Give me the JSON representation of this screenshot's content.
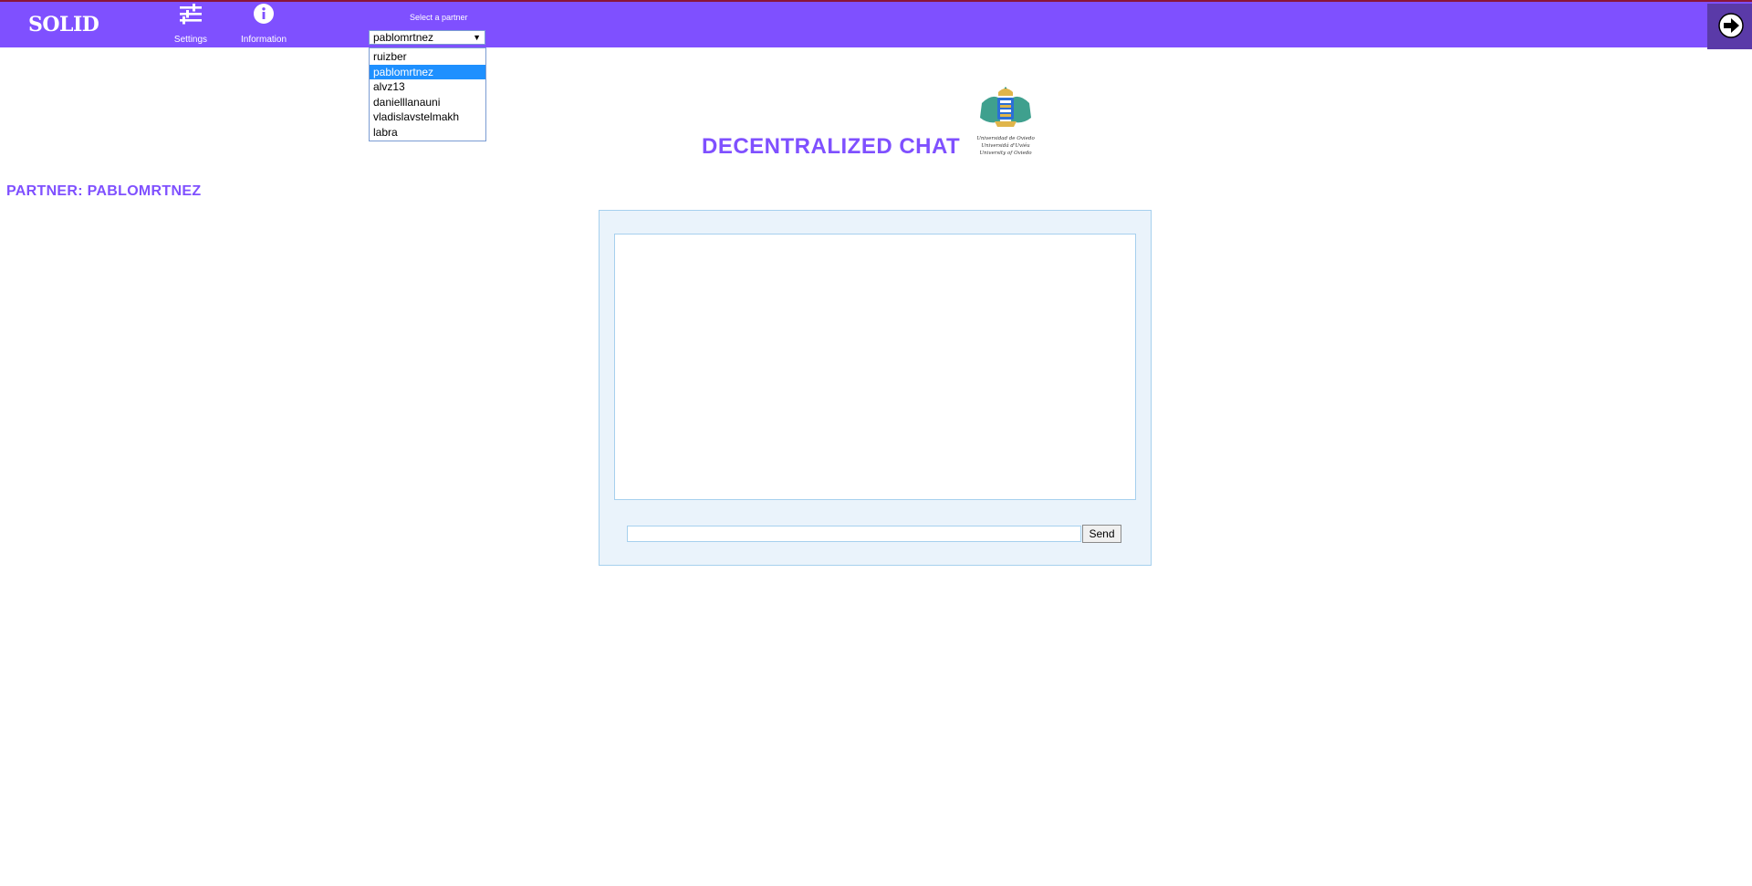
{
  "navbar": {
    "brand": "SOLID",
    "settings_label": "Settings",
    "information_label": "Information",
    "partner_select_label": "Select a partner"
  },
  "partner_select": {
    "selected": "pablomrtnez",
    "options": [
      "ruizber",
      "pablomrtnez",
      "alvz13",
      "danielllanauni",
      "vladislavstelmakh",
      "labra"
    ]
  },
  "main": {
    "title": "DECENTRALIZED CHAT",
    "logo_text": [
      "Universidad de Oviedo",
      "Universidá d'Uviéu",
      "University of Oviedo"
    ],
    "partner_heading": "PARTNER: PABLOMRTNEZ"
  },
  "chat": {
    "message_value": "",
    "send_label": "Send"
  },
  "icons": {
    "settings": "sliders-icon",
    "information": "info-icon",
    "logout": "logout-icon",
    "logo": "university-crest-logo"
  },
  "colors": {
    "accent": "#7f50ff",
    "panel_bg": "#eaf3fb",
    "panel_border": "#a6d0ee",
    "selected_option": "#1e90ff"
  }
}
